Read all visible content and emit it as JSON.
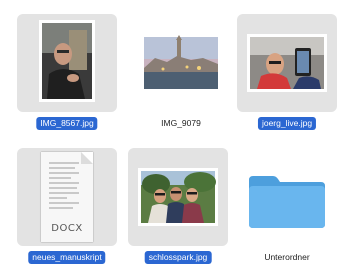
{
  "files": [
    {
      "name": "IMG_8567.jpg",
      "selected": true,
      "kind": "photo-portrait",
      "icon": "portrait-photo-thumbnail"
    },
    {
      "name": "IMG_9079",
      "selected": false,
      "kind": "photo-landscape",
      "icon": "landscape-photo-thumbnail"
    },
    {
      "name": "joerg_live.jpg",
      "selected": true,
      "kind": "photo-landscape",
      "icon": "selfie-photo-thumbnail"
    },
    {
      "name": "neues_manuskript",
      "selected": true,
      "kind": "document",
      "icon": "docx-document-icon",
      "ext": "DOCX"
    },
    {
      "name": "schlosspark.jpg",
      "selected": true,
      "kind": "photo-landscape",
      "icon": "group-photo-thumbnail"
    },
    {
      "name": "Unterordner",
      "selected": false,
      "kind": "folder",
      "icon": "folder-icon"
    }
  ],
  "colors": {
    "selection_label": "#2b67d2",
    "selection_tile": "#e3e3e3",
    "folder": "#5aaee8"
  }
}
